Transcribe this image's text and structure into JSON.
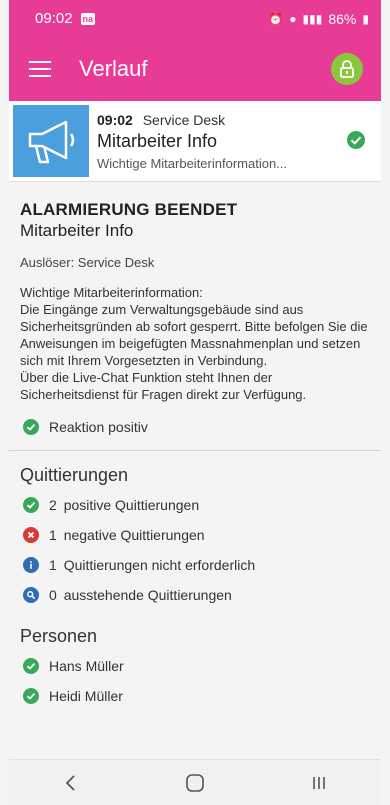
{
  "status_bar": {
    "time": "09:02",
    "battery": "86%"
  },
  "app_bar": {
    "title": "Verlauf",
    "menu_icon": "hamburger-icon",
    "lock_icon": "lock-icon"
  },
  "message": {
    "time": "09:02",
    "sender": "Service Desk",
    "title": "Mitarbeiter Info",
    "preview": "Wichtige Mitarbeiterinformation..."
  },
  "detail": {
    "status": "ALARMIERUNG BEENDET",
    "name": "Mitarbeiter Info",
    "trigger": "Auslöser: Service Desk",
    "body": "Wichtige Mitarbeiterinformation:\nDie Eingänge zum Verwaltungsgebäude sind aus Sicherheitsgründen ab sofort gesperrt. Bitte befolgen Sie die Anweisungen im beigefügten Massnahmenplan und setzen sich mit Ihrem Vorgesetzten in Verbindung.\nÜber die Live-Chat Funktion steht Ihnen der Sicherheitsdienst für Fragen direkt zur Verfügung.",
    "reaction": "Reaktion positiv"
  },
  "acknowledgements": {
    "title": "Quittierungen",
    "items": [
      {
        "count": "2",
        "label": "positive Quittierungen",
        "icon": "check-icon",
        "color": "#3aa85a"
      },
      {
        "count": "1",
        "label": "negative Quittierungen",
        "icon": "cross-icon",
        "color": "#d83a3a"
      },
      {
        "count": "1",
        "label": "Quittierungen nicht erforderlich",
        "icon": "info-icon",
        "color": "#2f6db5"
      },
      {
        "count": "0",
        "label": "ausstehende Quittierungen",
        "icon": "search-icon",
        "color": "#2f6db5"
      }
    ]
  },
  "persons": {
    "title": "Personen",
    "items": [
      {
        "name": "Hans Müller"
      },
      {
        "name": "Heidi Müller"
      }
    ]
  },
  "colors": {
    "accent": "#e83b96",
    "positive": "#3aa85a",
    "negative": "#d83a3a",
    "info": "#2f6db5",
    "lock": "#8cc63f",
    "thumb": "#4a9fdc"
  }
}
